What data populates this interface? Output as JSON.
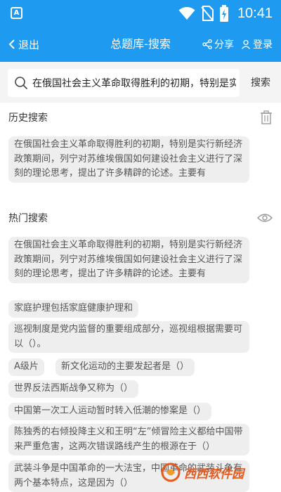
{
  "status_bar": {
    "app_badge": "A",
    "time": "10:41"
  },
  "nav": {
    "back_label": "退出",
    "title": "总题库-搜索",
    "share_label": "分享",
    "login_label": "登录"
  },
  "search": {
    "value": "在俄国社会主义革命取得胜利的初期，特别是实行新经济政策期间",
    "button_label": "搜索"
  },
  "history": {
    "title": "历史搜索",
    "items": [
      "在俄国社会主义革命取得胜利的初期，特别是实行新经济政策期间，列宁对苏维埃俄国如何建设社会主义进行了深刻的理论思考，提出了许多精辟的论述。主要有"
    ]
  },
  "hot": {
    "title": "热门搜索",
    "items": [
      "在俄国社会主义革命取得胜利的初期，特别是实行新经济政策期间，列宁对苏维埃俄国如何建设社会主义进行了深刻的理论思考，提出了许多精辟的论述。主要有",
      "家庭护理包括家庭健康护理和",
      "巡视制度是党内监督的重要组成部分，巡视组根据需要可以（）。",
      "A级片",
      "新文化运动的主要发起者是（）",
      "世界反法西斯战争又称为（）",
      "中国第一次工人运动暂时转入低潮的惨案是（）",
      "陈独秀的右倾投降主义和王明“左”倾冒险主义都给中国带来严重危害，这两次错误路线产生的根源在于（）",
      "武装斗争是中国革命的一大法宝，中国革命的武装斗争有两个基本特点，这是因为（）"
    ]
  },
  "watermark": {
    "text": "西西软件园"
  }
}
